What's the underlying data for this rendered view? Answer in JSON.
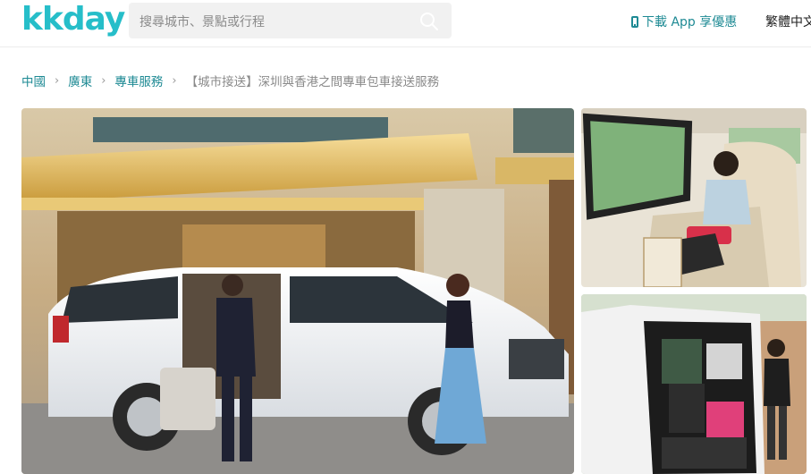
{
  "header": {
    "logo_text": "kkday",
    "search_placeholder": "搜尋城市、景點或行程",
    "app_link_label": "下載 App 享優惠",
    "language_label": "繁體中文"
  },
  "breadcrumb": {
    "items": [
      "中國",
      "廣東",
      "專車服務"
    ],
    "current": "【城市接送】深圳與香港之間專車包車接送服務"
  },
  "gallery": {
    "main_photo": "white-van-hotel-photo",
    "top_photo": "van-interior-passenger-photo",
    "bottom_photo": "van-trunk-luggage-photo"
  },
  "colors": {
    "brand": "#26bec9",
    "link": "#1e8a94"
  }
}
